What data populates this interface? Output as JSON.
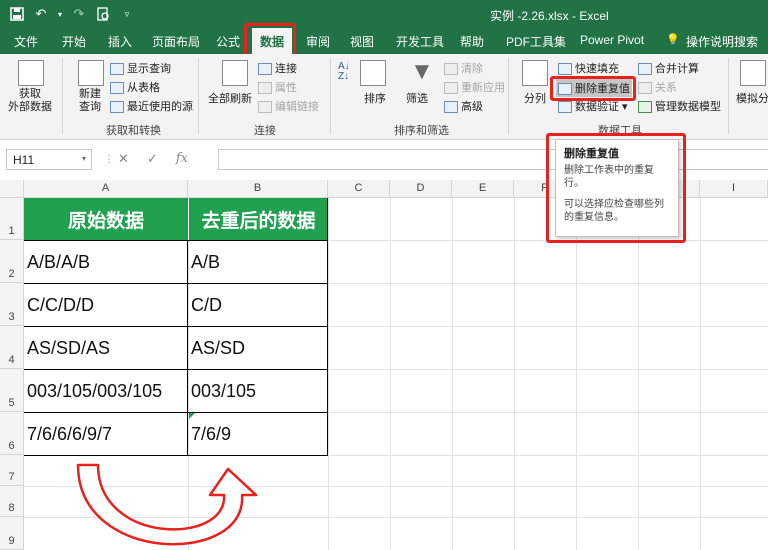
{
  "window": {
    "title": "实例 -2.26.xlsx  -  Excel"
  },
  "tabs": [
    "文件",
    "开始",
    "插入",
    "页面布局",
    "公式",
    "数据",
    "审阅",
    "视图",
    "开发工具",
    "帮助",
    "PDF工具集",
    "Power Pivot",
    "操作说明搜索"
  ],
  "ribbon": {
    "get_external": "获取\n外部数据",
    "new_query": "新建\n查询",
    "show_queries": "显示查询",
    "from_table": "从表格",
    "recent_sources": "最近使用的源",
    "group_get_transform": "获取和转换",
    "refresh_all": "全部刷新",
    "connections": "连接",
    "properties": "属性",
    "edit_links": "编辑链接",
    "group_connections": "连接",
    "sort": "排序",
    "filter": "筛选",
    "clear": "清除",
    "reapply": "重新应用",
    "advanced": "高级",
    "group_sort_filter": "排序和筛选",
    "text_to_columns": "分列",
    "flash_fill": "快速填充",
    "remove_duplicates": "删除重复值",
    "data_validation": "数据验证",
    "consolidate": "合并计算",
    "relationships": "关系",
    "manage_model": "管理数据模型",
    "group_data_tools": "数据工具",
    "what_if": "模拟分"
  },
  "formula_bar": {
    "name_box": "H11",
    "fx": "fx"
  },
  "columns": [
    "A",
    "B",
    "C",
    "D",
    "E",
    "F",
    "G",
    "H",
    "I"
  ],
  "rows": [
    "1",
    "2",
    "3",
    "4",
    "5",
    "6",
    "7",
    "8",
    "9"
  ],
  "sheet": {
    "header": [
      "原始数据",
      "去重后的数据"
    ],
    "rows": [
      [
        "A/B/A/B",
        "A/B"
      ],
      [
        "C/C/D/D",
        "C/D"
      ],
      [
        "AS/SD/AS",
        "AS/SD"
      ],
      [
        "003/105/003/105",
        "003/105"
      ],
      [
        "7/6/6/6/9/7",
        "7/6/9"
      ]
    ]
  },
  "tooltip": {
    "title": "删除重复值",
    "line1": "删除工作表中的重复行。",
    "line2": "可以选择应检查哪些列的重复信息。"
  },
  "colors": {
    "excel_green": "#217346",
    "header_green": "#1fa14f",
    "highlight_red": "#e8211c"
  }
}
